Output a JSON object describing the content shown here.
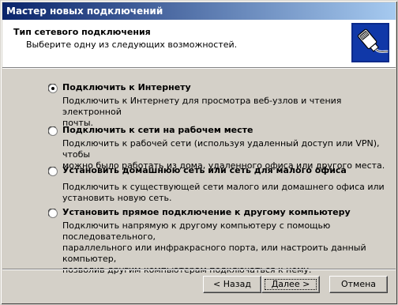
{
  "window": {
    "title": "Мастер новых подключений"
  },
  "header": {
    "title": "Тип сетевого подключения",
    "subtitle": "Выберите одну из следующих возможностей.",
    "icon": "network-cable-icon"
  },
  "options": [
    {
      "title": "Подключить к Интернету",
      "desc_line1": "Подключить к Интернету для просмотра веб-узлов и чтения  электронной",
      "desc_line2": "почты.",
      "selected": true
    },
    {
      "title": "Подключить к сети на рабочем месте",
      "desc_line1": "Подключить к рабочей сети (используя удаленный доступ или VPN), чтобы",
      "desc_line2": "можно было работать из дома, удаленного офиса или другого места.",
      "selected": false
    },
    {
      "title": "Установить домашнюю сеть или сеть для малого офиса",
      "desc_line1": "Подключить к существующей сети малого или домашнего офиса или",
      "desc_line2": "установить новую сеть.",
      "selected": false
    },
    {
      "title": "Установить прямое подключение к другому компьютеру",
      "desc_line1": "Подключить напрямую к другому компьютеру с помощью последовательного,",
      "desc_line2": "параллельного или инфракрасного порта, или настроить данный компьютер,",
      "desc_line3": "позволив другим  компьютерам подключаться к нему.",
      "selected": false
    }
  ],
  "buttons": {
    "back": "< Назад",
    "next": "Далее >",
    "cancel": "Отмена"
  },
  "colors": {
    "titlebar_start": "#0a246a",
    "titlebar_end": "#a6caf0",
    "face": "#d4d0c8"
  }
}
